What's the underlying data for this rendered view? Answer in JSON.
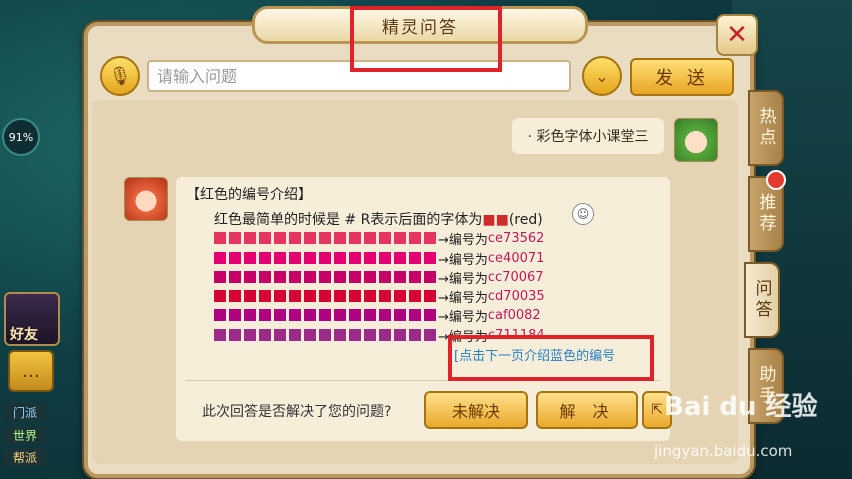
{
  "window": {
    "title": "精灵问答",
    "close_icon": "close-icon"
  },
  "input": {
    "placeholder": "请输入问题",
    "send_label": "发 送"
  },
  "hud": {
    "percent": "91%",
    "friend_label": "好友",
    "channels": [
      {
        "label": "门派"
      },
      {
        "label": "世界"
      },
      {
        "label": "帮派"
      }
    ]
  },
  "conversation": {
    "user_message": "· 彩色字体小课堂三",
    "bot_title": "【红色的编号介绍】",
    "bot_intro": "红色最简单的时候是 # R表示后面的字体为",
    "bot_intro_squares": "■■",
    "bot_intro_suffix": "(red)",
    "arrow_label": "→编号为",
    "codes": [
      {
        "code": "ce73562",
        "color": "#e73562"
      },
      {
        "code": "ce40071",
        "color": "#e40071"
      },
      {
        "code": "cc70067",
        "color": "#c70067"
      },
      {
        "code": "cd70035",
        "color": "#d70035"
      },
      {
        "code": "caf0082",
        "color": "#af0082"
      },
      {
        "code": "c711184",
        "color": "#9b2a8a"
      }
    ],
    "next_link": "[点击下一页介绍蓝色的编号",
    "solved_question": "此次回答是否解决了您的问题?",
    "unresolved_label": "未解决",
    "resolved_label": "解 决"
  },
  "side_tabs": [
    {
      "label": "热点",
      "active": false
    },
    {
      "label": "推荐",
      "active": false,
      "badge": true
    },
    {
      "label": "问答",
      "active": true
    },
    {
      "label": "助手",
      "active": false
    }
  ],
  "watermark": {
    "logo": "Bai du 经验",
    "url": "jingyan.baidu.com"
  },
  "colors": {
    "accent": "#e7a624",
    "highlight": "#e2222b",
    "link": "#2a7fc4"
  }
}
